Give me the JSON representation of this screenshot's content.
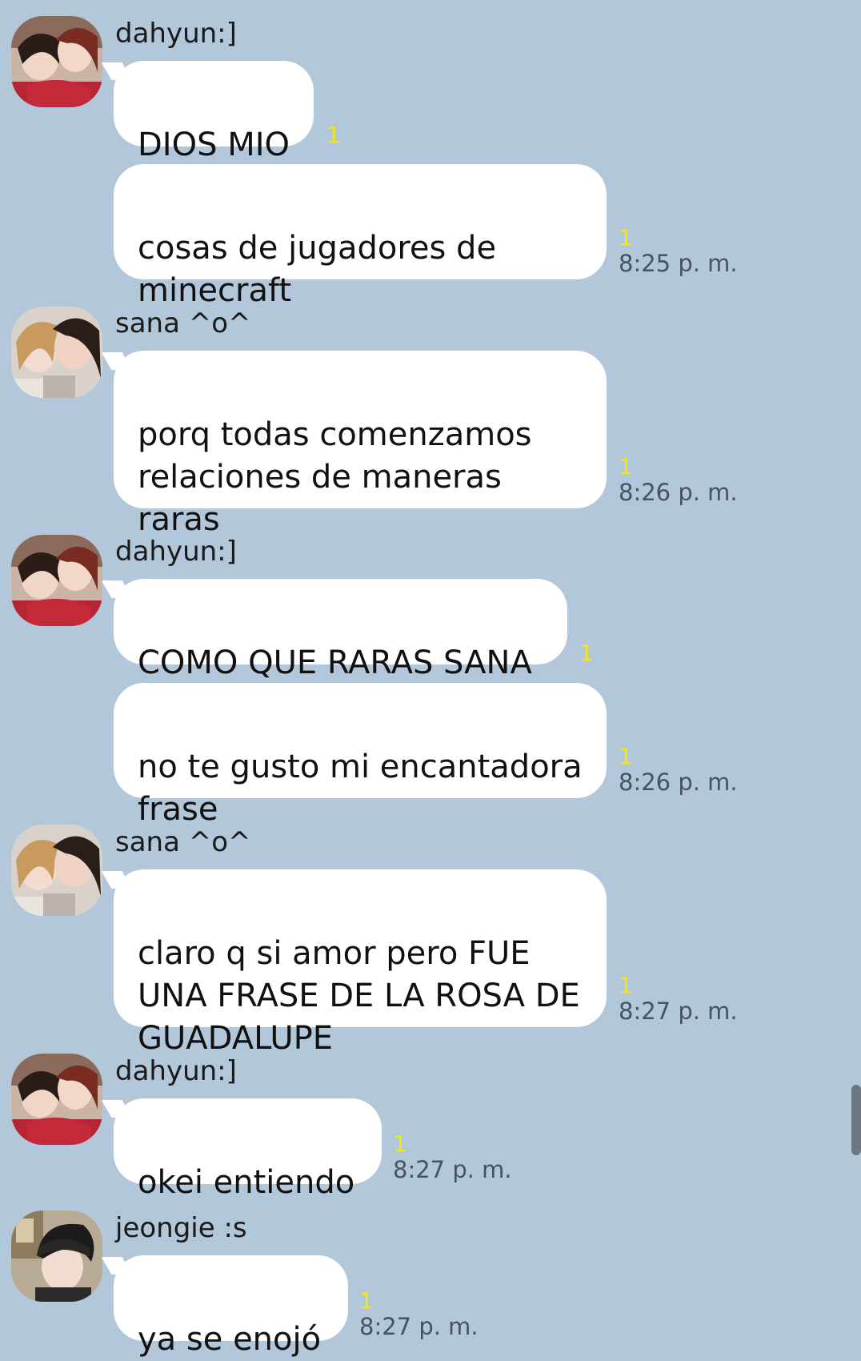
{
  "messages": [
    {
      "sender": "dahyun:]",
      "text": "DIOS MIO",
      "unread": "1"
    },
    {
      "text": "cosas de jugadores de\nminecraft",
      "unread": "1",
      "time": "8:25 p. m."
    },
    {
      "sender": "sana ^o^",
      "text": "porq todas comenzamos\nrelaciones de maneras\nraras",
      "unread": "1",
      "time": "8:26 p. m."
    },
    {
      "sender": "dahyun:]",
      "text": "COMO QUE RARAS SANA",
      "unread": "1"
    },
    {
      "text": "no te gusto mi encantadora\nfrase",
      "unread": "1",
      "time": "8:26 p. m."
    },
    {
      "sender": "sana ^o^",
      "text": "claro q si amor pero FUE\nUNA FRASE DE LA ROSA DE\nGUADALUPE",
      "unread": "1",
      "time": "8:27 p. m."
    },
    {
      "sender": "dahyun:]",
      "text": "okei entiendo",
      "unread": "1",
      "time": "8:27 p. m."
    },
    {
      "sender": "jeongie :s",
      "text": "ya se enojó",
      "unread": "1",
      "time": "8:27 p. m."
    }
  ],
  "colors": {
    "background": "#b2c7da",
    "bubble": "#ffffff",
    "unread": "#f4e41a",
    "time": "#47535f"
  },
  "icons": {
    "avatar_dahyun": "profile-photo",
    "avatar_sana": "profile-photo",
    "avatar_jeongie": "profile-photo"
  }
}
